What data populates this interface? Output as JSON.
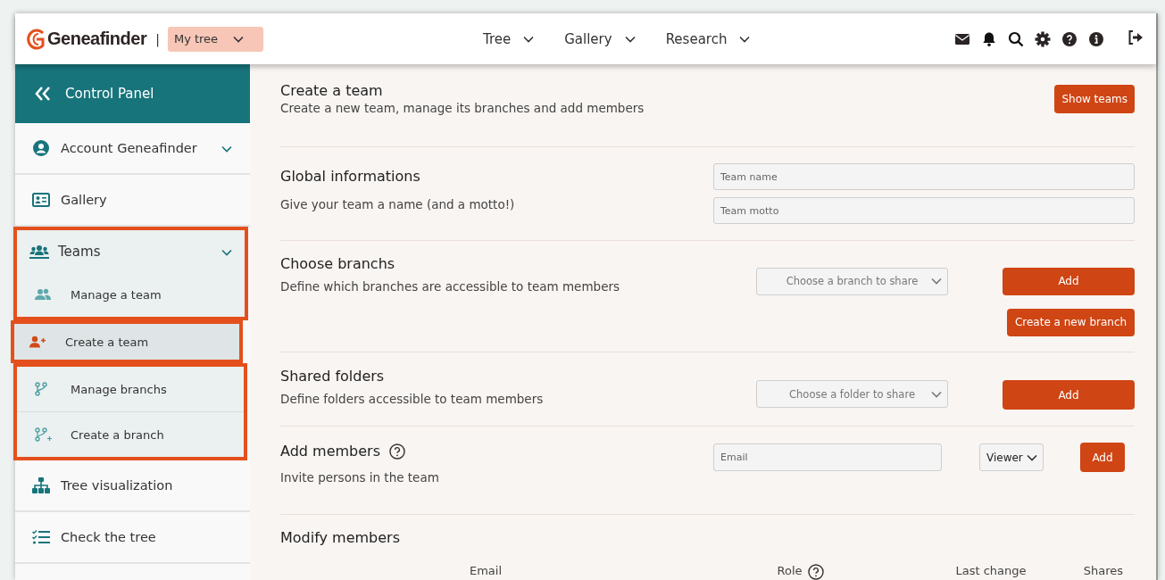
{
  "header": {
    "logo": "Geneafinder",
    "separator": "|",
    "tree_select": "My tree",
    "nav": [
      {
        "label": "Tree"
      },
      {
        "label": "Gallery"
      },
      {
        "label": "Research"
      }
    ]
  },
  "sidebar": {
    "title": "Control Panel",
    "items": [
      {
        "kind": "account",
        "label": "Account Geneafinder"
      },
      {
        "kind": "gallery",
        "label": "Gallery"
      },
      {
        "kind": "teams",
        "label": "Teams",
        "expanded": true,
        "children": [
          {
            "kind": "manage-team",
            "label": "Manage a team",
            "selected": false
          },
          {
            "kind": "create-team",
            "label": "Create a team",
            "selected": true
          },
          {
            "kind": "manage-branch",
            "label": "Manage branchs",
            "selected": false
          },
          {
            "kind": "create-branch",
            "label": "Create a branch",
            "selected": false
          }
        ]
      },
      {
        "kind": "tree",
        "label": "Tree visualization"
      },
      {
        "kind": "check",
        "label": "Check the tree"
      }
    ]
  },
  "main": {
    "sections": [
      {
        "kind": "intro",
        "title": "Create a team",
        "description": "Create a new team, manage its branches and add members",
        "button": "Show teams"
      },
      {
        "kind": "global",
        "title": "Global informations",
        "description": "Give your team a name (and a motto!)",
        "fields": [
          {
            "placeholder": "Team name"
          },
          {
            "placeholder": "Team motto"
          }
        ]
      },
      {
        "kind": "branches",
        "title": "Choose branchs",
        "description": "Define which branches are accessible to team members",
        "select": "Choose a branch to share",
        "button": "Add",
        "button_2": "Create a new branch"
      },
      {
        "kind": "folders",
        "title": "Shared folders",
        "description": "Define folders accessible to team members",
        "select": "Choose a folder to share",
        "button": "Add"
      },
      {
        "kind": "members",
        "title": "Add members",
        "help": true,
        "description": "Invite persons in the team",
        "field": {
          "placeholder": "Email"
        },
        "select": "Viewer",
        "button": "Add"
      },
      {
        "kind": "table",
        "title": "Modify members",
        "columns": [
          {
            "label": "Email"
          },
          {
            "label": "Role",
            "help": true
          },
          {
            "label": "Last change"
          },
          {
            "label": "Shares"
          }
        ]
      }
    ]
  }
}
